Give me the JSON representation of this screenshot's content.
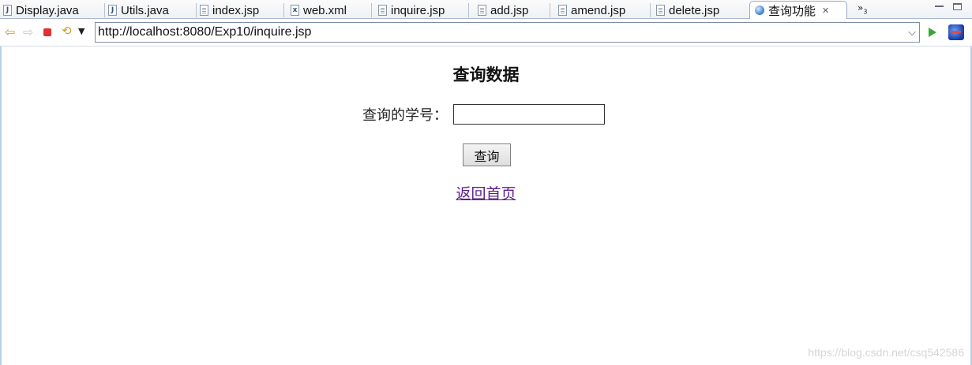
{
  "tabs": [
    {
      "label": "Display.java",
      "icon": "java-file-icon"
    },
    {
      "label": "Utils.java",
      "icon": "java-file-icon"
    },
    {
      "label": "index.jsp",
      "icon": "jsp-file-icon"
    },
    {
      "label": "web.xml",
      "icon": "xml-file-icon"
    },
    {
      "label": "inquire.jsp",
      "icon": "jsp-file-icon"
    },
    {
      "label": "add.jsp",
      "icon": "jsp-file-icon"
    },
    {
      "label": "amend.jsp",
      "icon": "jsp-file-icon"
    },
    {
      "label": "delete.jsp",
      "icon": "jsp-file-icon"
    },
    {
      "label": "查询功能",
      "icon": "globe-icon",
      "active": true
    }
  ],
  "tab_overflow": {
    "symbol": "»",
    "count": "3"
  },
  "toolbar": {
    "url": "http://localhost:8080/Exp10/inquire.jsp"
  },
  "page": {
    "title": "查询数据",
    "field_label": "查询的学号：",
    "field_value": "",
    "button_label": "查询",
    "home_link": "返回首页"
  },
  "watermark": "https://blog.csdn.net/csq542586",
  "colors": {
    "link_visited": "#5a1d8a",
    "tab_border": "#99acc4"
  }
}
